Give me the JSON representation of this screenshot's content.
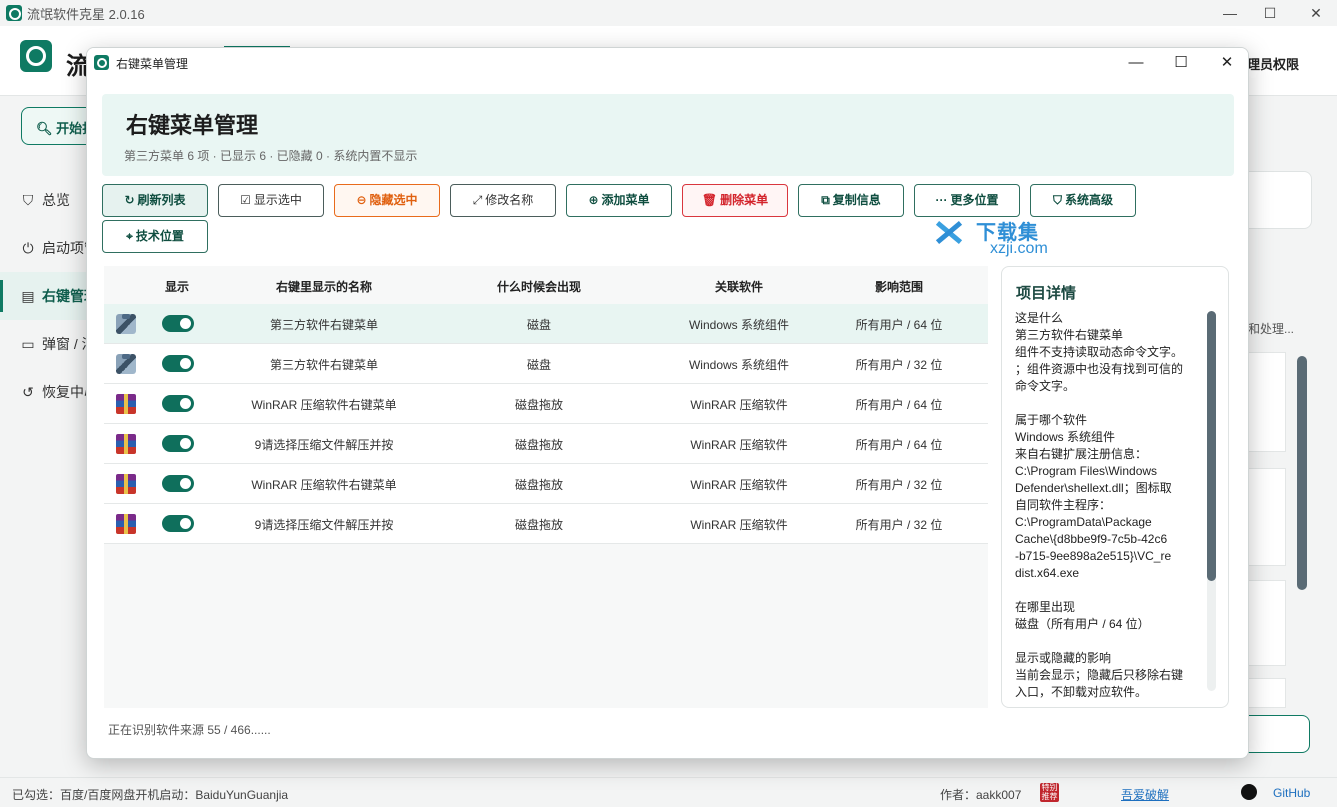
{
  "main_window": {
    "title": "流氓软件克星 2.0.16",
    "brand_char": "流",
    "admin_text": "理员权限",
    "start_button": "开始扫",
    "sidebar": [
      {
        "icon": "shield-icon",
        "glyph": "⛉",
        "label": "总览"
      },
      {
        "icon": "power-icon",
        "glyph": "⏻",
        "label": "启动项管"
      },
      {
        "icon": "menu-icon",
        "glyph": "▤",
        "label": "右键管理",
        "active": true
      },
      {
        "icon": "popup-icon",
        "glyph": "▭",
        "label": "弹窗 / 浮"
      },
      {
        "icon": "restore-icon",
        "glyph": "↺",
        "label": "恢复中心"
      }
    ],
    "right_partial_text": "和处理...",
    "status": {
      "selected": "已勾选：百度/百度网盘开机启动：BaiduYunGuanjia",
      "author": "作者：aakk007",
      "seal_text": "特别推荐",
      "crack_link": "吾爱破解",
      "github": "GitHub"
    }
  },
  "dialog": {
    "title": "右键菜单管理",
    "banner_title": "右键菜单管理",
    "banner_sub": "第三方菜单 6 项 · 已显示 6 · 已隐藏 0 · 系统内置不显示",
    "toolbar": [
      {
        "name": "refresh-list-button",
        "icon": "↻",
        "label": "刷新列表",
        "style": "primary"
      },
      {
        "name": "show-selected-button",
        "icon": "☑",
        "label": "显示选中",
        "style": ""
      },
      {
        "name": "hide-selected-button",
        "icon": "⊖",
        "label": "隐藏选中",
        "style": "orange"
      },
      {
        "name": "rename-button",
        "icon": "⤢",
        "label": "修改名称",
        "style": ""
      },
      {
        "name": "add-menu-button",
        "icon": "⊕",
        "label": "添加菜单",
        "style": "teal"
      },
      {
        "name": "delete-menu-button",
        "icon": "🗑",
        "label": "删除菜单",
        "style": "red"
      },
      {
        "name": "copy-info-button",
        "icon": "⧉",
        "label": "复制信息",
        "style": "teal"
      },
      {
        "name": "more-locations-button",
        "icon": "···",
        "label": "更多位置",
        "style": "teal"
      },
      {
        "name": "system-advanced-button",
        "icon": "⛉",
        "label": "系统高级",
        "style": "teal"
      },
      {
        "name": "tech-location-button",
        "icon": "⌖",
        "label": "技术位置",
        "style": "teal"
      }
    ],
    "watermark": {
      "cn": "下载集",
      "en": "xzji.com"
    },
    "columns": [
      "显示",
      "右键里显示的名称",
      "什么时候会出现",
      "关联软件",
      "影响范围"
    ],
    "rows": [
      {
        "icon": "defender",
        "shown": true,
        "name": "第三方软件右键菜单",
        "when": "磁盘",
        "software": "Windows 系统组件",
        "scope": "所有用户 / 64 位",
        "selected": true
      },
      {
        "icon": "defender",
        "shown": true,
        "name": "第三方软件右键菜单",
        "when": "磁盘",
        "software": "Windows 系统组件",
        "scope": "所有用户 / 32 位",
        "selected": false
      },
      {
        "icon": "winrar",
        "shown": true,
        "name": "WinRAR 压缩软件右键菜单",
        "when": "磁盘拖放",
        "software": "WinRAR 压缩软件",
        "scope": "所有用户 / 64 位",
        "selected": false
      },
      {
        "icon": "winrar",
        "shown": true,
        "name": "9请选择压缩文件解压并按",
        "when": "磁盘拖放",
        "software": "WinRAR 压缩软件",
        "scope": "所有用户 / 64 位",
        "selected": false
      },
      {
        "icon": "winrar",
        "shown": true,
        "name": "WinRAR 压缩软件右键菜单",
        "when": "磁盘拖放",
        "software": "WinRAR 压缩软件",
        "scope": "所有用户 / 32 位",
        "selected": false
      },
      {
        "icon": "winrar",
        "shown": true,
        "name": "9请选择压缩文件解压并按",
        "when": "磁盘拖放",
        "software": "WinRAR 压缩软件",
        "scope": "所有用户 / 32 位",
        "selected": false
      }
    ],
    "detail": {
      "title": "项目详情",
      "lines": [
        "这是什么",
        "第三方软件右键菜单",
        "组件不支持读取动态命令文字。",
        "；组件资源中也没有找到可信的",
        "命令文字。",
        "",
        "属于哪个软件",
        "Windows 系统组件",
        "来自右键扩展注册信息：",
        "C:\\Program Files\\Windows",
        "Defender\\shellext.dll；图标取",
        "自同软件主程序：",
        "C:\\ProgramData\\Package",
        "Cache\\{d8bbe9f9-7c5b-42c6",
        "-b715-9ee898a2e515}\\VC_re",
        "dist.x64.exe",
        "",
        "在哪里出现",
        "磁盘（所有用户 / 64 位）",
        "",
        "显示或隐藏的影响",
        "当前会显示；隐藏后只移除右键",
        "入口，不卸载对应软件。"
      ]
    },
    "status": "正在识别软件来源 55 / 466......"
  }
}
